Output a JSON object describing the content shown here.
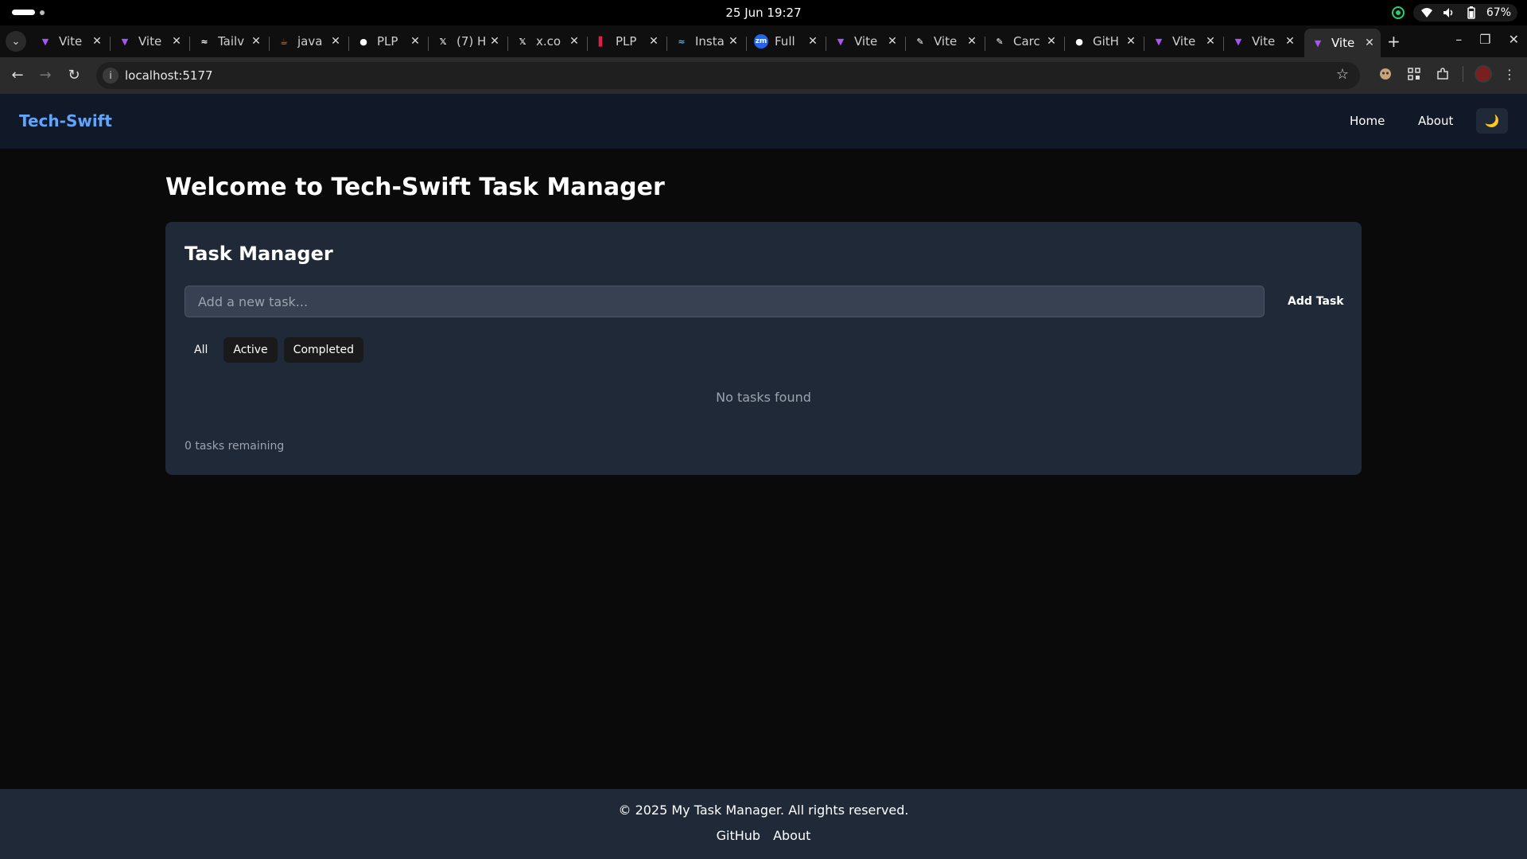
{
  "os": {
    "clock": "25 Jun  19:27",
    "battery": "67%"
  },
  "browser": {
    "tabs": [
      {
        "title": "Vite",
        "icon": "vite-icon",
        "color": "#a855f7"
      },
      {
        "title": "Vite",
        "icon": "vite-icon",
        "color": "#a855f7"
      },
      {
        "title": "Tailv",
        "icon": "tailwind-icon",
        "color": "#ffffff"
      },
      {
        "title": "java",
        "icon": "java-icon",
        "color": "#f97316"
      },
      {
        "title": "PLP",
        "icon": "github-icon",
        "color": "#ffffff"
      },
      {
        "title": "(7) H",
        "icon": "x-icon",
        "color": "#ffffff"
      },
      {
        "title": "x.co",
        "icon": "x-icon",
        "color": "#ffffff"
      },
      {
        "title": "PLP",
        "icon": "plp-icon",
        "color": "#e11d48"
      },
      {
        "title": "Insta",
        "icon": "tailwind-icon",
        "color": "#38bdf8"
      },
      {
        "title": "Full",
        "icon": "zm-icon",
        "color": "#2563eb"
      },
      {
        "title": "Vite",
        "icon": "vite-icon",
        "color": "#a855f7"
      },
      {
        "title": "Vite",
        "icon": "pen-icon",
        "color": "#ffffff"
      },
      {
        "title": "Carc",
        "icon": "pen-icon",
        "color": "#ffffff"
      },
      {
        "title": "GitH",
        "icon": "github-icon",
        "color": "#ffffff"
      },
      {
        "title": "Vite",
        "icon": "vite-icon",
        "color": "#a855f7"
      },
      {
        "title": "Vite",
        "icon": "vite-icon",
        "color": "#a855f7"
      },
      {
        "title": "Vite",
        "icon": "vite-icon",
        "color": "#a855f7"
      }
    ],
    "active_tab": 16,
    "url": "localhost:5177"
  },
  "app": {
    "brand": "Tech-Swift",
    "nav": {
      "home": "Home",
      "about": "About",
      "theme_icon": "🌙"
    },
    "heading": "Welcome to Tech-Swift Task Manager",
    "card": {
      "title": "Task Manager",
      "input_placeholder": "Add a new task...",
      "input_value": "",
      "add_button": "Add Task",
      "filters": [
        "All",
        "Active",
        "Completed"
      ],
      "active_filter": "All",
      "empty_message": "No tasks found",
      "remaining": "0 tasks remaining"
    },
    "footer": {
      "copyright": "© 2025 My Task Manager. All rights reserved.",
      "links": [
        "GitHub",
        "About"
      ]
    },
    "colors": {
      "accent": "#60a5fa",
      "nav_bg": "#111827",
      "card_bg": "#1f2937",
      "page_bg": "#0a0a0a"
    }
  }
}
